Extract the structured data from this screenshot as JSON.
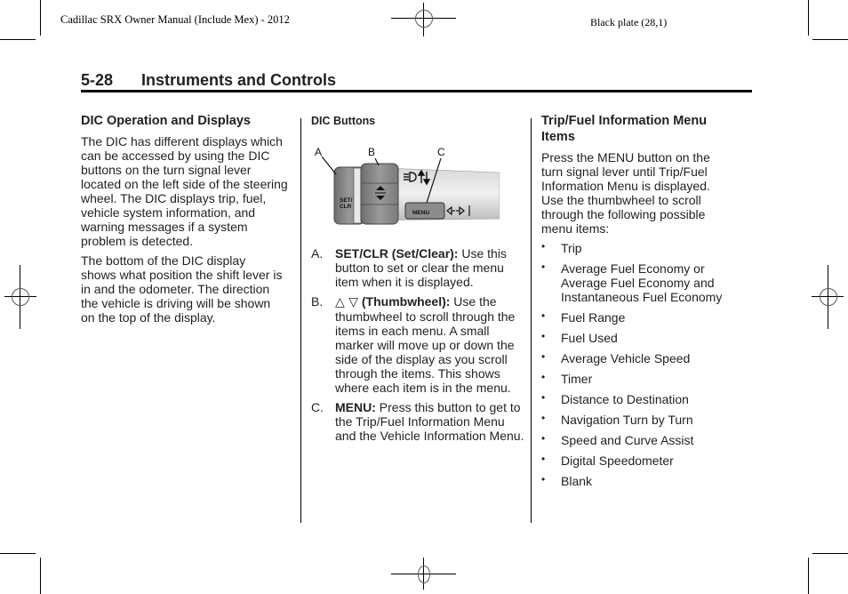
{
  "running_header": {
    "left": "Cadillac SRX Owner Manual (Include Mex) - 2012",
    "right": "Black plate (28,1)"
  },
  "page_heading": {
    "number": "5-28",
    "title": "Instruments and Controls"
  },
  "column1": {
    "heading": "DIC Operation and Displays",
    "paragraphs": [
      "The DIC has different displays which can be accessed by using the DIC buttons on the turn signal lever located on the left side of the steering wheel. The DIC displays trip, fuel, vehicle system information, and warning messages if a system problem is detected.",
      "The bottom of the DIC display shows what position the shift lever is in and the odometer. The direction the vehicle is driving will be shown on the top of the display."
    ]
  },
  "column2": {
    "heading": "DIC Buttons",
    "figure": {
      "callouts": [
        "A",
        "B",
        "C"
      ],
      "button_set_label": "SET/\nCLR",
      "button_menu_label": "MENU",
      "icon_names": [
        "set-clr-button",
        "thumbwheel-icon",
        "menu-button",
        "headlamp-beam-icon",
        "turn-arrows-icon"
      ]
    },
    "items": [
      {
        "marker": "A.",
        "bold": "SET/CLR (Set/Clear):",
        "text": " Use this button to set or clear the menu item when it is displayed."
      },
      {
        "marker": "B.",
        "symbols": "△ ▽",
        "bold": " (Thumbwheel):",
        "text": " Use the thumbwheel to scroll through the items in each menu. A small marker will move up or down the side of the display as you scroll through the items. This shows where each item is in the menu."
      },
      {
        "marker": "C.",
        "bold": "MENU:",
        "text": " Press this button to get to the Trip/Fuel Information Menu and the Vehicle Information Menu."
      }
    ]
  },
  "column3": {
    "heading": "Trip/Fuel Information Menu Items",
    "intro": "Press the MENU button on the turn signal lever until Trip/Fuel Information Menu is displayed. Use the thumbwheel to scroll through the following possible menu items:",
    "bullet": "•",
    "menu_items": [
      "Trip",
      "Average Fuel Economy or Average Fuel Economy and Instantaneous Fuel Economy",
      "Fuel Range",
      "Fuel Used",
      "Average Vehicle Speed",
      "Timer",
      "Distance to Destination",
      "Navigation Turn by Turn",
      "Speed and Curve Assist",
      "Digital Speedometer",
      "Blank"
    ]
  }
}
